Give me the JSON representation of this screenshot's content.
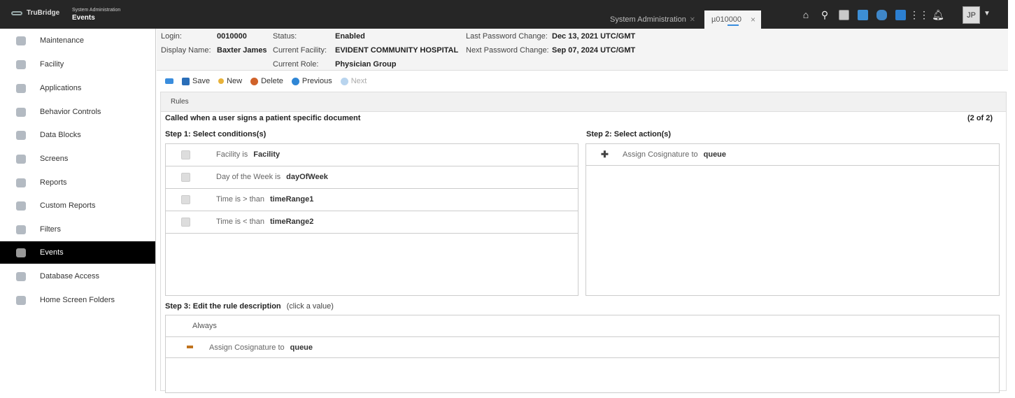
{
  "app": {
    "brand": "TruBridge",
    "subtitle": "System Administration",
    "title": "Events"
  },
  "tabs": [
    {
      "label": "System Administration"
    },
    {
      "label": "µ010000"
    }
  ],
  "user_avatar": "JP",
  "top_icons": [
    "home-icon",
    "search-icon",
    "checklist-icon",
    "table-icon",
    "database-icon",
    "edit-window-icon",
    "apps-grid-icon",
    "bell-icon"
  ],
  "colors": {
    "topbar": "#262626",
    "active_sidebar": "#000000",
    "accent_tab": "#3a8ddd",
    "remove_icon": "#c0731e"
  },
  "sidebar": {
    "items": [
      {
        "label": "Maintenance",
        "icon": "maintenance-icon"
      },
      {
        "label": "Facility",
        "icon": "facility-icon"
      },
      {
        "label": "Applications",
        "icon": "applications-icon"
      },
      {
        "label": "Behavior Controls",
        "icon": "behavior-icon"
      },
      {
        "label": "Data Blocks",
        "icon": "data-blocks-icon"
      },
      {
        "label": "Screens",
        "icon": "screens-icon"
      },
      {
        "label": "Reports",
        "icon": "reports-icon"
      },
      {
        "label": "Custom Reports",
        "icon": "custom-reports-icon"
      },
      {
        "label": "Filters",
        "icon": "filter-icon"
      },
      {
        "label": "Events",
        "icon": "events-icon",
        "active": true
      },
      {
        "label": "Database Access",
        "icon": "database-access-icon"
      },
      {
        "label": "Home Screen Folders",
        "icon": "home-folders-icon"
      }
    ]
  },
  "info": {
    "login_label": "Login:",
    "login": "0010000",
    "display_label": "Display Name:",
    "display": "Baxter James",
    "status_label": "Status:",
    "status": "Enabled",
    "facility_label": "Current Facility:",
    "facility": "EVIDENT COMMUNITY HOSPITAL",
    "role_label": "Current Role:",
    "role": "Physician Group",
    "lpc_label": "Last Password Change:",
    "lpc": "Dec 13, 2021 UTC/GMT",
    "npc_label": "Next Password Change:",
    "npc": "Sep 07, 2024 UTC/GMT"
  },
  "toolbar": {
    "save": "Save",
    "new": "New",
    "delete": "Delete",
    "previous": "Previous",
    "next": "Next"
  },
  "rules": {
    "header": "Rules",
    "title": "Called when a user signs a patient specific document",
    "counter": "(2 of 2)",
    "step1": "Step 1: Select conditions(s)",
    "step2": "Step 2: Select action(s)",
    "conditions": [
      {
        "text": "Facility is",
        "value": "Facility"
      },
      {
        "text": "Day of the Week is",
        "value": "dayOfWeek"
      },
      {
        "text": "Time is > than",
        "value": "timeRange1"
      },
      {
        "text": "Time is < than",
        "value": "timeRange2"
      }
    ],
    "action": {
      "text": "Assign Cosignature to",
      "value": "queue"
    },
    "step3": "Step 3: Edit the rule description",
    "step3_hint": "(click a value)",
    "desc_always": "Always",
    "desc_action": {
      "text": "Assign Cosignature to",
      "value": "queue"
    }
  }
}
